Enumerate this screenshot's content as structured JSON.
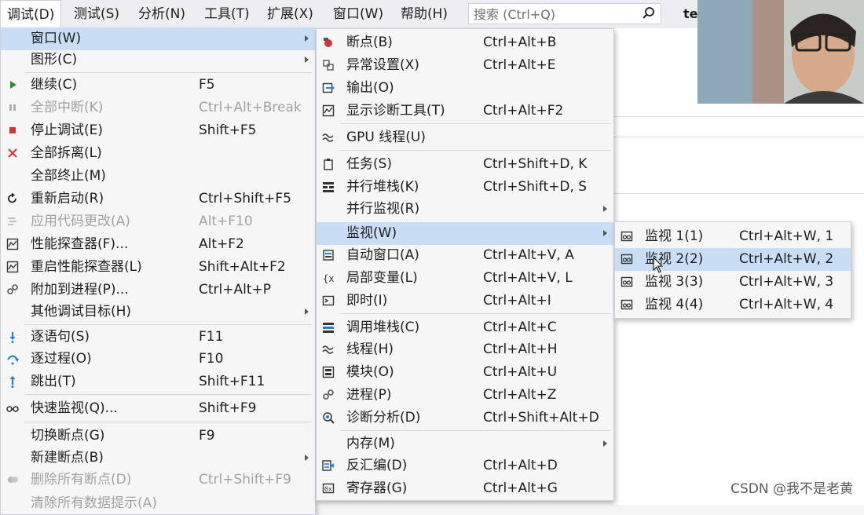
{
  "menubar": {
    "items": [
      "调试(D)",
      "测试(S)",
      "分析(N)",
      "工具(T)",
      "扩展(X)",
      "窗口(W)",
      "帮助(H)"
    ],
    "search_placeholder": "搜索 (Ctrl+Q)",
    "tab_fragment": "te"
  },
  "debug_menu": {
    "items": [
      {
        "label": "窗口(W)",
        "shortcut": "",
        "submenu": true,
        "icon": ""
      },
      {
        "label": "图形(C)",
        "shortcut": "",
        "submenu": true,
        "icon": ""
      },
      {
        "label": "继续(C)",
        "shortcut": "F5",
        "icon": "play-icon"
      },
      {
        "label": "全部中断(K)",
        "shortcut": "Ctrl+Alt+Break",
        "disabled": true,
        "icon": "pause-icon"
      },
      {
        "label": "停止调试(E)",
        "shortcut": "Shift+F5",
        "icon": "stop-icon"
      },
      {
        "label": "全部拆离(L)",
        "shortcut": "",
        "icon": "detach-icon"
      },
      {
        "label": "全部终止(M)",
        "shortcut": "",
        "icon": ""
      },
      {
        "label": "重新启动(R)",
        "shortcut": "Ctrl+Shift+F5",
        "icon": "restart-icon"
      },
      {
        "label": "应用代码更改(A)",
        "shortcut": "Alt+F10",
        "disabled": true,
        "icon": "apply-code-icon"
      },
      {
        "label": "性能探查器(F)...",
        "shortcut": "Alt+F2",
        "icon": "profiler-icon"
      },
      {
        "label": "重启性能探查器(L)",
        "shortcut": "Shift+Alt+F2",
        "icon": "profiler-restart-icon"
      },
      {
        "label": "附加到进程(P)...",
        "shortcut": "Ctrl+Alt+P",
        "icon": "attach-icon"
      },
      {
        "label": "其他调试目标(H)",
        "shortcut": "",
        "submenu": true,
        "icon": ""
      },
      {
        "label": "逐语句(S)",
        "shortcut": "F11",
        "icon": "step-into-icon"
      },
      {
        "label": "逐过程(O)",
        "shortcut": "F10",
        "icon": "step-over-icon"
      },
      {
        "label": "跳出(T)",
        "shortcut": "Shift+F11",
        "icon": "step-out-icon"
      },
      {
        "label": "快速监视(Q)...",
        "shortcut": "Shift+F9",
        "icon": "quickwatch-icon"
      },
      {
        "label": "切换断点(G)",
        "shortcut": "F9",
        "icon": ""
      },
      {
        "label": "新建断点(B)",
        "shortcut": "",
        "submenu": true,
        "icon": ""
      },
      {
        "label": "删除所有断点(D)",
        "shortcut": "Ctrl+Shift+F9",
        "disabled": true,
        "icon": "delete-breakpoints-icon"
      },
      {
        "label": "清除所有数据提示(A)",
        "shortcut": "",
        "disabled": true,
        "icon": ""
      }
    ]
  },
  "window_menu": {
    "items": [
      {
        "label": "断点(B)",
        "shortcut": "Ctrl+Alt+B",
        "icon": "breakpoint-icon"
      },
      {
        "label": "异常设置(X)",
        "shortcut": "Ctrl+Alt+E",
        "icon": "exception-icon"
      },
      {
        "label": "输出(O)",
        "shortcut": "",
        "icon": "output-icon"
      },
      {
        "label": "显示诊断工具(T)",
        "shortcut": "Ctrl+Alt+F2",
        "icon": "diagnostic-icon"
      },
      {
        "label": "GPU 线程(U)",
        "shortcut": "",
        "icon": "gpu-thread-icon"
      },
      {
        "label": "任务(S)",
        "shortcut": "Ctrl+Shift+D, K",
        "icon": "task-icon"
      },
      {
        "label": "并行堆栈(K)",
        "shortcut": "Ctrl+Shift+D, S",
        "icon": "parallel-stack-icon"
      },
      {
        "label": "并行监视(R)",
        "shortcut": "",
        "submenu": true,
        "icon": ""
      },
      {
        "label": "监视(W)",
        "shortcut": "",
        "submenu": true,
        "highlighted": true,
        "icon": ""
      },
      {
        "label": "自动窗口(A)",
        "shortcut": "Ctrl+Alt+V, A",
        "icon": "autos-icon"
      },
      {
        "label": "局部变量(L)",
        "shortcut": "Ctrl+Alt+V, L",
        "icon": "locals-icon"
      },
      {
        "label": "即时(I)",
        "shortcut": "Ctrl+Alt+I",
        "icon": "immediate-icon"
      },
      {
        "label": "调用堆栈(C)",
        "shortcut": "Ctrl+Alt+C",
        "icon": "call-stack-icon"
      },
      {
        "label": "线程(H)",
        "shortcut": "Ctrl+Alt+H",
        "icon": "threads-icon"
      },
      {
        "label": "模块(O)",
        "shortcut": "Ctrl+Alt+U",
        "icon": "modules-icon"
      },
      {
        "label": "进程(P)",
        "shortcut": "Ctrl+Alt+Z",
        "icon": "processes-icon"
      },
      {
        "label": "诊断分析(D)",
        "shortcut": "Ctrl+Shift+Alt+D",
        "icon": "diagnostic-analysis-icon"
      },
      {
        "label": "内存(M)",
        "shortcut": "",
        "submenu": true,
        "icon": ""
      },
      {
        "label": "反汇编(D)",
        "shortcut": "Ctrl+Alt+D",
        "icon": "disassembly-icon"
      },
      {
        "label": "寄存器(G)",
        "shortcut": "Ctrl+Alt+G",
        "icon": "registers-icon"
      }
    ]
  },
  "watch_menu": {
    "items": [
      {
        "label": "监视 1(1)",
        "shortcut": "Ctrl+Alt+W, 1",
        "icon": "watch-icon"
      },
      {
        "label": "监视 2(2)",
        "shortcut": "Ctrl+Alt+W, 2",
        "highlighted": true,
        "icon": "watch-icon"
      },
      {
        "label": "监视 3(3)",
        "shortcut": "Ctrl+Alt+W, 3",
        "icon": "watch-icon"
      },
      {
        "label": "监视 4(4)",
        "shortcut": "Ctrl+Alt+W, 4",
        "icon": "watch-icon"
      }
    ]
  },
  "watermark": "CSDN @我不是老黄",
  "colors": {
    "highlight": "#c9def5",
    "menu_bg": "#f6f6f6",
    "disabled_text": "#a2a2a2",
    "accent_red": "#d13438",
    "accent_blue": "#1e7bd6"
  }
}
